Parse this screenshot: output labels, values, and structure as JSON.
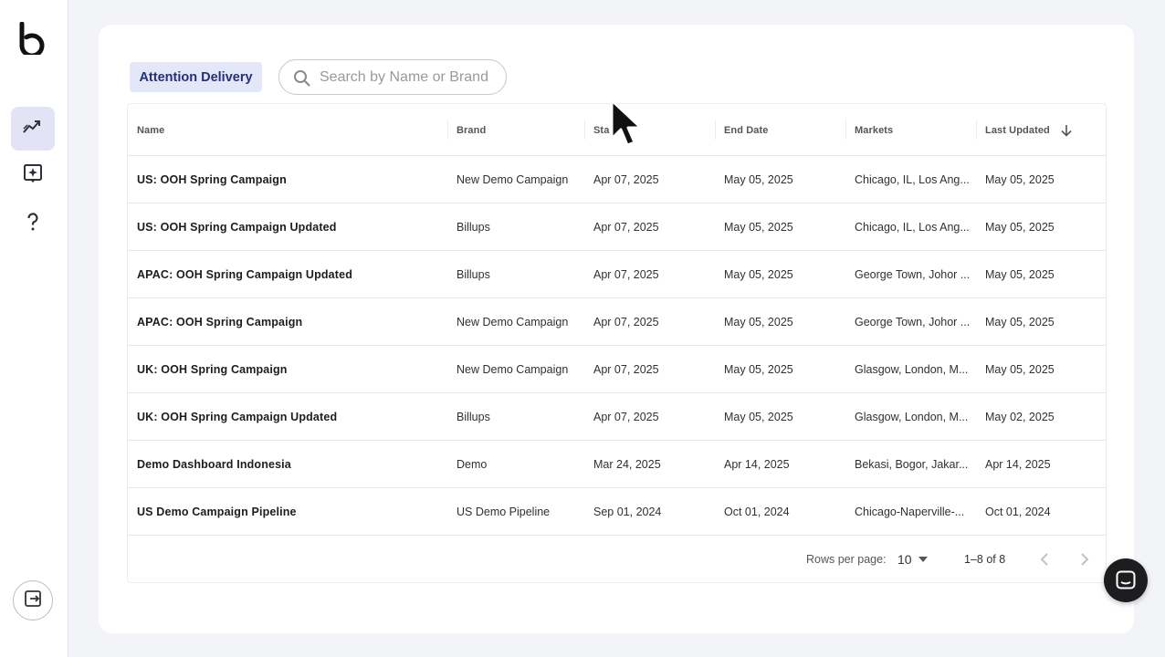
{
  "sidebar": {
    "logo_icon": "brand-b-logo-icon",
    "items": [
      {
        "name": "analytics",
        "icon": "trending-up-icon",
        "active": true
      },
      {
        "name": "add-report",
        "icon": "add-box-sparkle-icon",
        "active": false
      },
      {
        "name": "help",
        "icon": "question-mark-icon",
        "active": false
      }
    ],
    "exit_icon": "exit-to-app-icon"
  },
  "toolbar": {
    "filter_label": "Attention Delivery",
    "search": {
      "placeholder": "Search by Name or Brand",
      "value": "",
      "icon": "search-icon"
    }
  },
  "table": {
    "columns": [
      "Name",
      "Brand",
      "Start Date",
      "End Date",
      "Markets",
      "Last Updated"
    ],
    "column_visible_labels": [
      "Name",
      "Brand",
      "Sta",
      "End Date",
      "Markets",
      "Last Updated"
    ],
    "sort_column": "Last Updated",
    "sort_icon": "arrow-down-icon",
    "rows": [
      {
        "name": "US: OOH Spring Campaign",
        "brand": "New Demo Campaign",
        "start": "Apr 07, 2025",
        "end": "May 05, 2025",
        "markets": "Chicago, IL, Los Ang...",
        "updated": "May 05, 2025"
      },
      {
        "name": "US: OOH Spring Campaign Updated",
        "brand": "Billups",
        "start": "Apr 07, 2025",
        "end": "May 05, 2025",
        "markets": "Chicago, IL, Los Ang...",
        "updated": "May 05, 2025"
      },
      {
        "name": "APAC: OOH Spring Campaign Updated",
        "brand": "Billups",
        "start": "Apr 07, 2025",
        "end": "May 05, 2025",
        "markets": "George Town, Johor ...",
        "updated": "May 05, 2025"
      },
      {
        "name": "APAC: OOH Spring Campaign",
        "brand": "New Demo Campaign",
        "start": "Apr 07, 2025",
        "end": "May 05, 2025",
        "markets": "George Town, Johor ...",
        "updated": "May 05, 2025"
      },
      {
        "name": "UK: OOH Spring Campaign",
        "brand": "New Demo Campaign",
        "start": "Apr 07, 2025",
        "end": "May 05, 2025",
        "markets": "Glasgow, London, M...",
        "updated": "May 05, 2025"
      },
      {
        "name": "UK: OOH Spring Campaign Updated",
        "brand": "Billups",
        "start": "Apr 07, 2025",
        "end": "May 05, 2025",
        "markets": "Glasgow, London, M...",
        "updated": "May 02, 2025"
      },
      {
        "name": "Demo Dashboard Indonesia",
        "brand": "Demo",
        "start": "Mar 24, 2025",
        "end": "Apr 14, 2025",
        "markets": "Bekasi, Bogor, Jakar...",
        "updated": "Apr 14, 2025"
      },
      {
        "name": "US Demo Campaign Pipeline",
        "brand": "US Demo Pipeline",
        "start": "Sep 01, 2024",
        "end": "Oct 01, 2024",
        "markets": "Chicago-Naperville-...",
        "updated": "Oct 01, 2024"
      }
    ]
  },
  "pagination": {
    "rows_per_page_label": "Rows per page:",
    "rows_per_page": "10",
    "range": "1–8 of 8",
    "prev_icon": "chevron-left-icon",
    "next_icon": "chevron-right-icon"
  },
  "chat": {
    "icon": "chat-bubble-icon"
  },
  "colors": {
    "accent_chip_bg": "#e4e7f7",
    "accent_chip_text": "#24307a",
    "active_nav_bg": "#e2e4f6"
  }
}
